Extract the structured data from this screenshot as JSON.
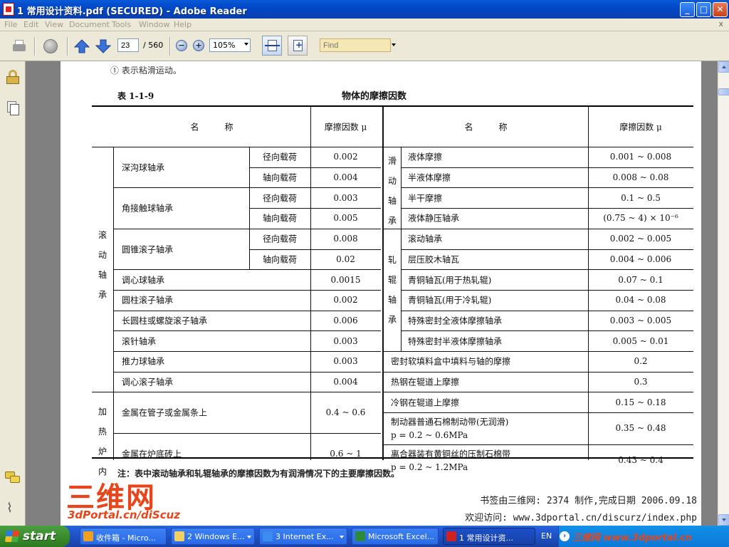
{
  "window": {
    "title": "1 常用设计资料.pdf (SECURED) - Adobe Reader",
    "controls": {
      "minimize": "_",
      "maximize": "□",
      "close": "✕"
    }
  },
  "menu": {
    "items": [
      "File",
      "Edit",
      "View",
      "Document",
      "Tools",
      "Window",
      "Help"
    ],
    "close_glyph": "x"
  },
  "toolbar": {
    "current_page": "23",
    "total_pages": "/ 560",
    "zoom": "105%",
    "find_placeholder": "Find"
  },
  "document": {
    "note_top": "① 表示粘滑运动。",
    "table_number": "表 1-1-9",
    "table_title": "物体的摩擦因数",
    "headers": {
      "left_name": "名　　　称",
      "left_coef": "摩擦因数 μ",
      "right_name": "名　　　称",
      "right_coef": "摩擦因数 μ"
    },
    "left_groups": {
      "rolling": [
        "滚",
        "动",
        "轴",
        "承"
      ],
      "furnace": [
        "加",
        "热",
        "炉",
        "内"
      ]
    },
    "left_rows": [
      {
        "name": "深沟球轴承",
        "sub": "径向载荷",
        "mu": "0.002"
      },
      {
        "name": "",
        "sub": "轴向载荷",
        "mu": "0.004"
      },
      {
        "name": "角接触球轴承",
        "sub": "径向载荷",
        "mu": "0.003"
      },
      {
        "name": "",
        "sub": "轴向载荷",
        "mu": "0.005"
      },
      {
        "name": "圆锥滚子轴承",
        "sub": "径向载荷",
        "mu": "0.008"
      },
      {
        "name": "",
        "sub": "轴向载荷",
        "mu": "0.02"
      },
      {
        "name": "调心球轴承",
        "sub": "",
        "mu": "0.0015"
      },
      {
        "name": "圆柱滚子轴承",
        "sub": "",
        "mu": "0.002"
      },
      {
        "name": "长圆柱或螺旋滚子轴承",
        "sub": "",
        "mu": "0.006"
      },
      {
        "name": "滚针轴承",
        "sub": "",
        "mu": "0.003"
      },
      {
        "name": "推力球轴承",
        "sub": "",
        "mu": "0.003"
      },
      {
        "name": "调心滚子轴承",
        "sub": "",
        "mu": "0.004"
      },
      {
        "name": "金属在管子或金属条上",
        "sub": "",
        "mu": "0.4 ~ 0.6"
      },
      {
        "name": "金属在炉底砖上",
        "sub": "",
        "mu": "0.6 ~ 1"
      }
    ],
    "right_groups": {
      "sliding": [
        "滑",
        "动",
        "轴",
        "承"
      ],
      "roll_neck": [
        "轧",
        "辊",
        "轴",
        "承"
      ]
    },
    "right_rows": [
      {
        "name": "液体摩擦",
        "mu": "0.001 ~ 0.008"
      },
      {
        "name": "半液体摩擦",
        "mu": "0.008 ~ 0.08"
      },
      {
        "name": "半干摩擦",
        "mu": "0.1 ~ 0.5"
      },
      {
        "name": "液体静压轴承",
        "mu": "(0.75 ~ 4) × 10⁻⁶"
      },
      {
        "name": "滚动轴承",
        "mu": "0.002 ~ 0.005"
      },
      {
        "name": "层压胶木轴瓦",
        "mu": "0.004 ~ 0.006"
      },
      {
        "name": "青铜轴瓦(用于热轧辊)",
        "mu": "0.07 ~ 0.1"
      },
      {
        "name": "青铜轴瓦(用于冷轧辊)",
        "mu": "0.04 ~ 0.08"
      },
      {
        "name": "特殊密封全液体摩擦轴承",
        "mu": "0.003 ~ 0.005"
      },
      {
        "name": "特殊密封半液体摩擦轴承",
        "mu": "0.005 ~ 0.01"
      },
      {
        "name": "密封软填料盒中填料与轴的摩擦",
        "mu": "0.2"
      },
      {
        "name": "热钢在辊道上摩擦",
        "mu": "0.3"
      },
      {
        "name": "冷钢在辊道上摩擦",
        "mu": "0.15 ~ 0.18"
      },
      {
        "name": "制动器普通石棉制动带(无润滑)",
        "name2": "p = 0.2 ~ 0.6MPa",
        "mu": "0.35 ~ 0.48"
      },
      {
        "name": "离合器装有黄铜丝的压制石棉带",
        "name2": "p = 0.2 ~ 1.2MPa",
        "mu": "0.43 ~ 0.4"
      }
    ],
    "page_note": "注：表中滚动轴承和轧辊轴承的摩擦因数为有润滑情况下的主要摩擦因数。",
    "watermark": {
      "logo_big": "三维网",
      "logo_small": "3dPortal.cn/diScuz",
      "line1": "书签由三维网: 2374  制作,完成日期 2006.09.18",
      "line2": "欢迎访问: www.3dportal.cn/discurz/index.php"
    }
  },
  "taskbar": {
    "start": "start",
    "tasks": [
      {
        "label": "收件箱 - Micro...",
        "color": "#f0a020"
      },
      {
        "label": "2 Windows E...",
        "color": "#f0d060"
      },
      {
        "label": "3 Internet Ex...",
        "color": "#3a8ef0"
      },
      {
        "label": "Microsoft Excel...",
        "color": "#2e8a3a"
      },
      {
        "label": "1 常用设计资...",
        "color": "#d02020"
      }
    ],
    "lang": "EN",
    "tray_watermark": "三维网 www.3dportal.cn"
  }
}
